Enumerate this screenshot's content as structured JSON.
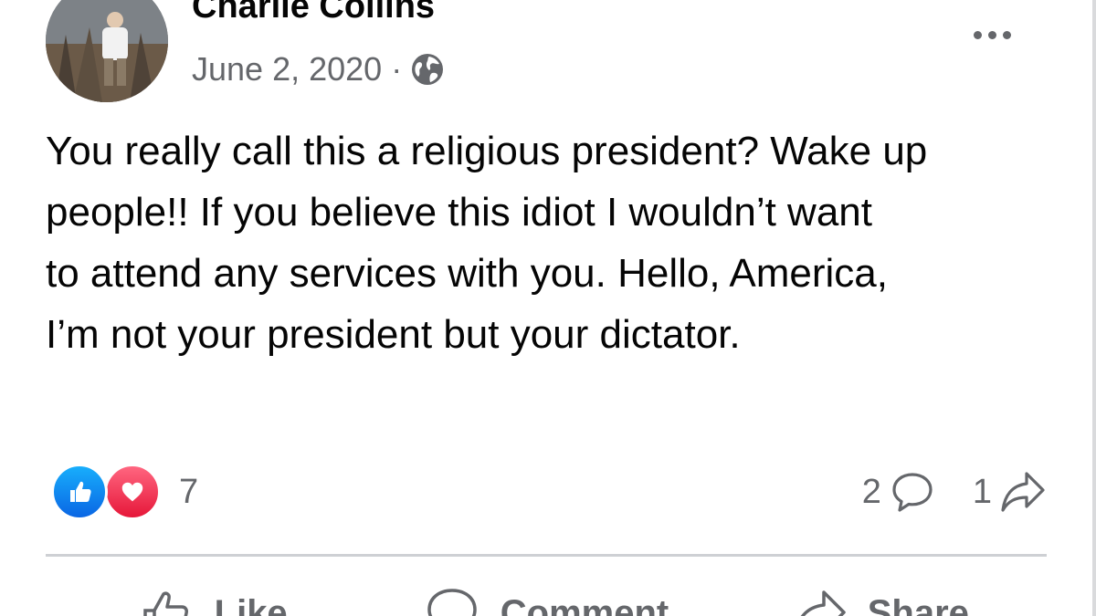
{
  "post": {
    "author": "Charlie Collins",
    "date": "June 2, 2020",
    "separator": "·",
    "audience_icon": "globe-icon",
    "more_icon": "more-options-icon",
    "text_lines": [
      "You really call this a religious president? Wake up",
      "people!! If you believe this idiot I wouldn’t want",
      "to attend any services with you. Hello, America,",
      "I’m not your president but your dictator."
    ],
    "reactions": {
      "icons": [
        "like-icon",
        "love-icon"
      ],
      "count": "7"
    },
    "comments_count": "2",
    "shares_count": "1",
    "actions": {
      "like": "Like",
      "comment": "Comment",
      "share": "Share"
    },
    "colors": {
      "like_blue": "#0a66e4",
      "love_red": "#e61739",
      "secondary_text": "#65676b"
    }
  }
}
